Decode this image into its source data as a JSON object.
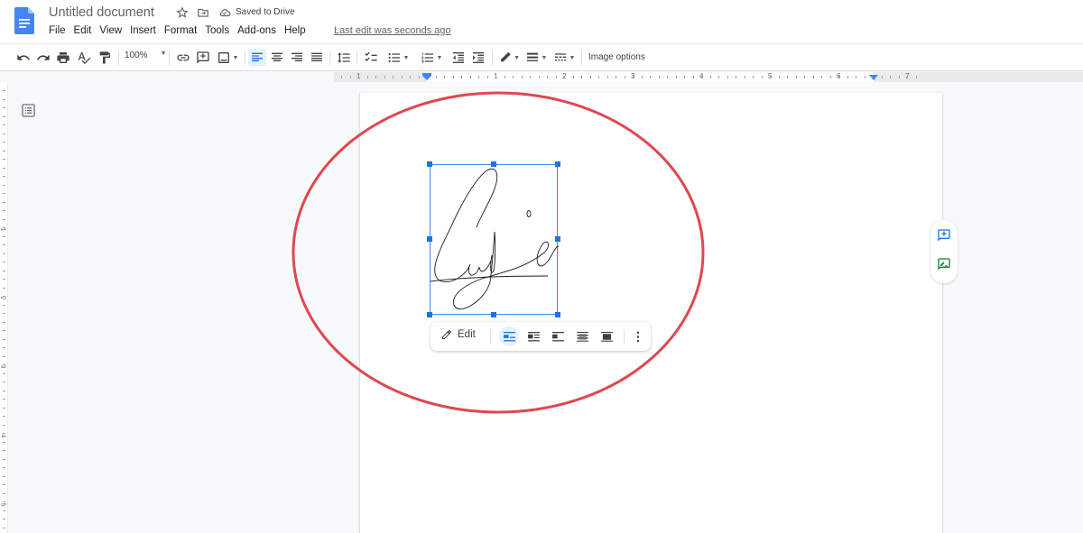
{
  "app": {
    "document_title": "Untitled document",
    "save_status": "Saved to Drive",
    "last_edit": "Last edit was seconds ago"
  },
  "menu": [
    "File",
    "Edit",
    "View",
    "Insert",
    "Format",
    "Tools",
    "Add-ons",
    "Help"
  ],
  "toolbar": {
    "zoom": "100%",
    "image_options_label": "Image options",
    "icons": [
      "undo-icon",
      "redo-icon",
      "print-icon",
      "spellcheck-icon",
      "paint-format-icon",
      "link-icon",
      "add-comment-icon",
      "insert-image-icon",
      "align-left-icon",
      "align-center-icon",
      "align-right-icon",
      "justify-icon",
      "line-spacing-icon",
      "checklist-icon",
      "bulleted-list-icon",
      "numbered-list-icon",
      "decrease-indent-icon",
      "increase-indent-icon",
      "border-color-icon",
      "border-weight-icon",
      "border-dash-icon"
    ],
    "active_alignment": "left"
  },
  "ruler": {
    "horizontal_labels": [
      "1",
      "1",
      "2",
      "3",
      "4",
      "5",
      "6",
      "7"
    ],
    "vertical_labels": [
      "1",
      "2",
      "3",
      "4",
      "5"
    ]
  },
  "image_toolbar": {
    "edit_label": "Edit",
    "wrap_options": [
      "in-line",
      "wrap-text",
      "break-text",
      "behind-text",
      "in-front-of-text"
    ],
    "active_wrap": "in-line"
  },
  "side_actions": [
    "add-comment",
    "suggest-edits"
  ],
  "image": {
    "description": "handwritten signature drawing",
    "selected": true
  },
  "annotation": {
    "shape": "ellipse",
    "color": "#e0474f"
  },
  "colors": {
    "accent": "#1a73e8",
    "doc_blue": "#4285f4",
    "suggest_green": "#188038"
  }
}
